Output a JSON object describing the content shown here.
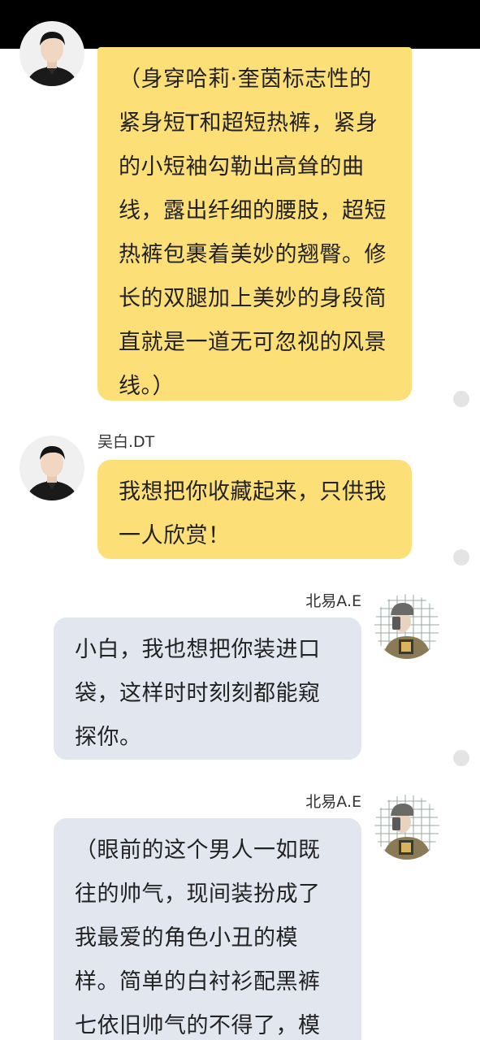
{
  "messages": [
    {
      "sender": "",
      "text": "（身穿哈莉·奎茵标志性的\n紧身短T和超短热裤，紧身\n的小短袖勾勒出高耸的曲\n线，露出纤细的腰肢，超短\n热裤包裹着美妙的翘臀。修\n长的双腿加上美妙的身段简\n直就是一道无可忽视的风景\n线。）"
    },
    {
      "sender": "吴白.DT",
      "text": "我想把你收藏起来，只供我\n一人欣赏！"
    },
    {
      "sender": "北易A.E",
      "text": "小白，我也想把你装进口\n袋，这样时时刻刻都能窥\n探你。"
    },
    {
      "sender": "北易A.E",
      "text": "（眼前的这个男人一如既\n往的帅气，现间装扮成了\n我最爱的角色小丑的模\n样。简单的白衬衫配黑裤\n七依旧帅气的不得了，模"
    }
  ],
  "colors": {
    "left_bubble": "#fddf78",
    "right_bubble": "#e1e6ef",
    "status_bar": "#000000"
  }
}
